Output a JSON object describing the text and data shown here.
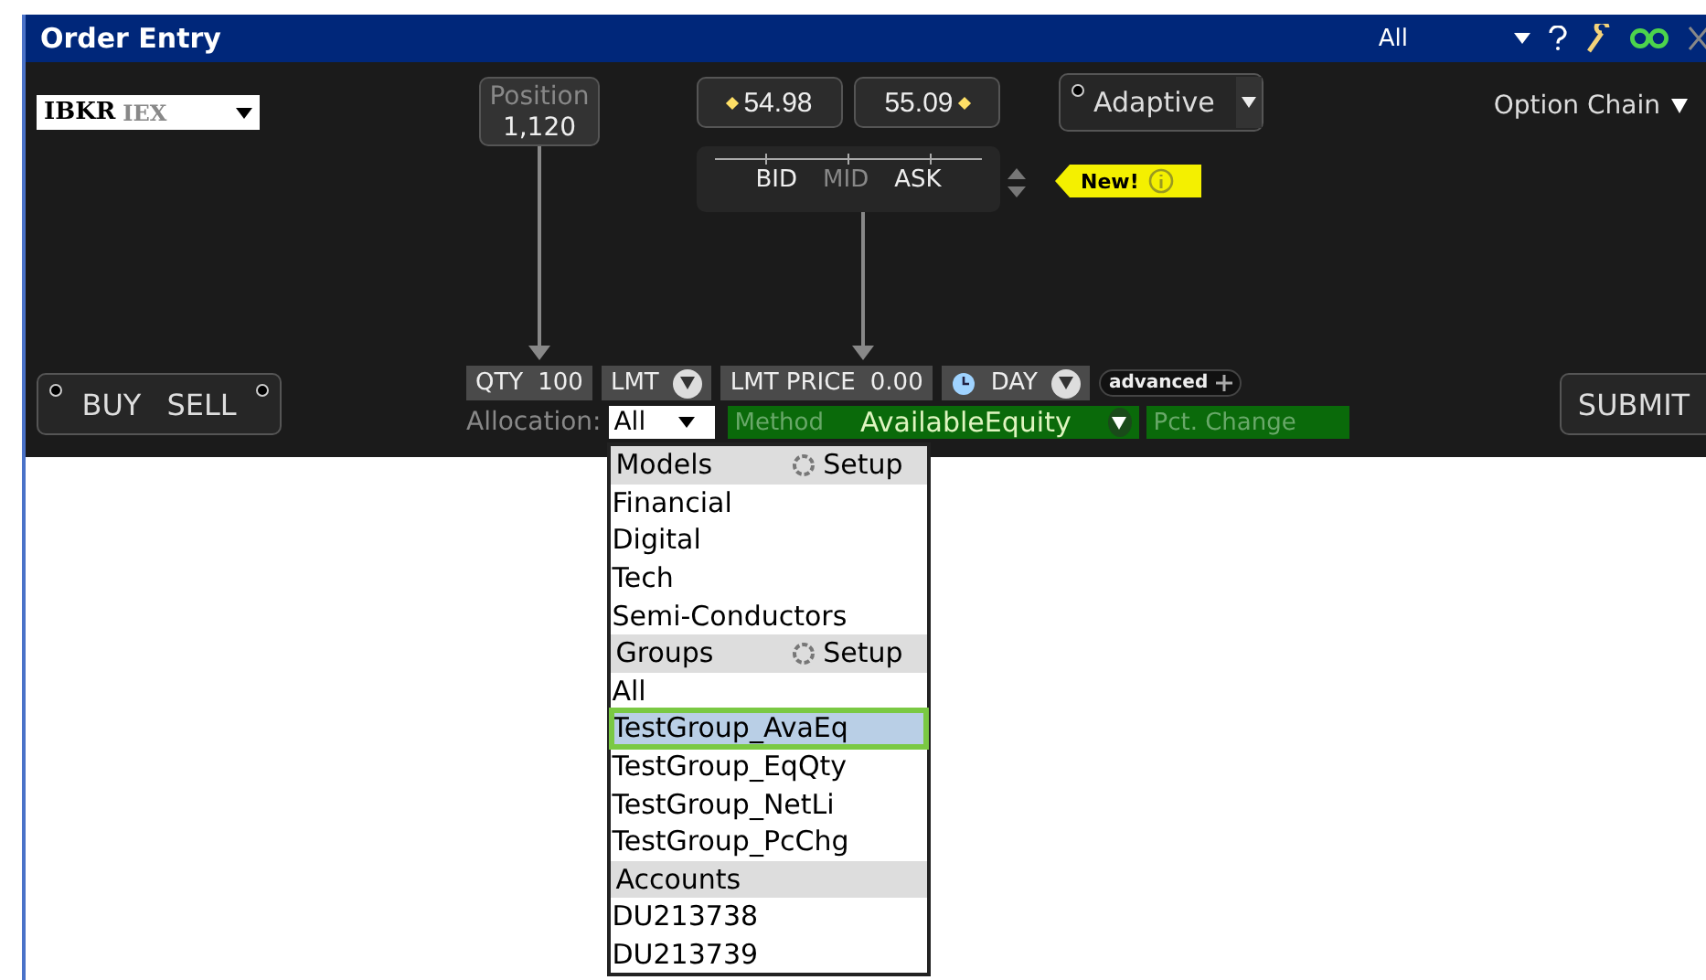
{
  "window": {
    "title": "Order Entry",
    "group": "All"
  },
  "symbol": {
    "ticker": "IBKR",
    "exchange": "IEX"
  },
  "position": {
    "label": "Position",
    "value": "1,120"
  },
  "bid": {
    "price": "54.98"
  },
  "ask": {
    "price": "55.09"
  },
  "price_scale": [
    {
      "label": "BID",
      "active": true
    },
    {
      "label": "MID",
      "active": false
    },
    {
      "label": "ASK",
      "active": true
    }
  ],
  "new_badge": "New!",
  "algo": {
    "label": "Adaptive"
  },
  "option_chain": "Option Chain",
  "side_buttons": [
    "BUY",
    "SELL"
  ],
  "order": {
    "qty_label": "QTY",
    "qty": "100",
    "type": "LMT",
    "price_label": "LMT PRICE",
    "price": "0.00",
    "tif": "DAY",
    "advanced": "advanced"
  },
  "allocation": {
    "label": "Allocation:",
    "value": "All",
    "method_label": "Method",
    "method": "AvailableEquity",
    "pct_placeholder": "Pct. Change"
  },
  "submit": "SUBMIT",
  "menu": {
    "sections": [
      {
        "title": "Models",
        "action": "Setup",
        "items": [
          {
            "label": "Financial",
            "selected": false
          },
          {
            "label": "Digital",
            "selected": false
          },
          {
            "label": "Tech",
            "selected": false
          },
          {
            "label": "Semi-Conductors",
            "selected": false
          }
        ]
      },
      {
        "title": "Groups",
        "action": "Setup",
        "items": [
          {
            "label": "All",
            "selected": false
          },
          {
            "label": "TestGroup_AvaEq",
            "selected": true
          },
          {
            "label": "TestGroup_EqQty",
            "selected": false
          },
          {
            "label": "TestGroup_NetLi",
            "selected": false
          },
          {
            "label": "TestGroup_PcChg",
            "selected": false
          }
        ]
      },
      {
        "title": "Accounts",
        "items": [
          {
            "label": "DU213738",
            "selected": false
          },
          {
            "label": "DU213739",
            "selected": false
          }
        ]
      }
    ]
  }
}
